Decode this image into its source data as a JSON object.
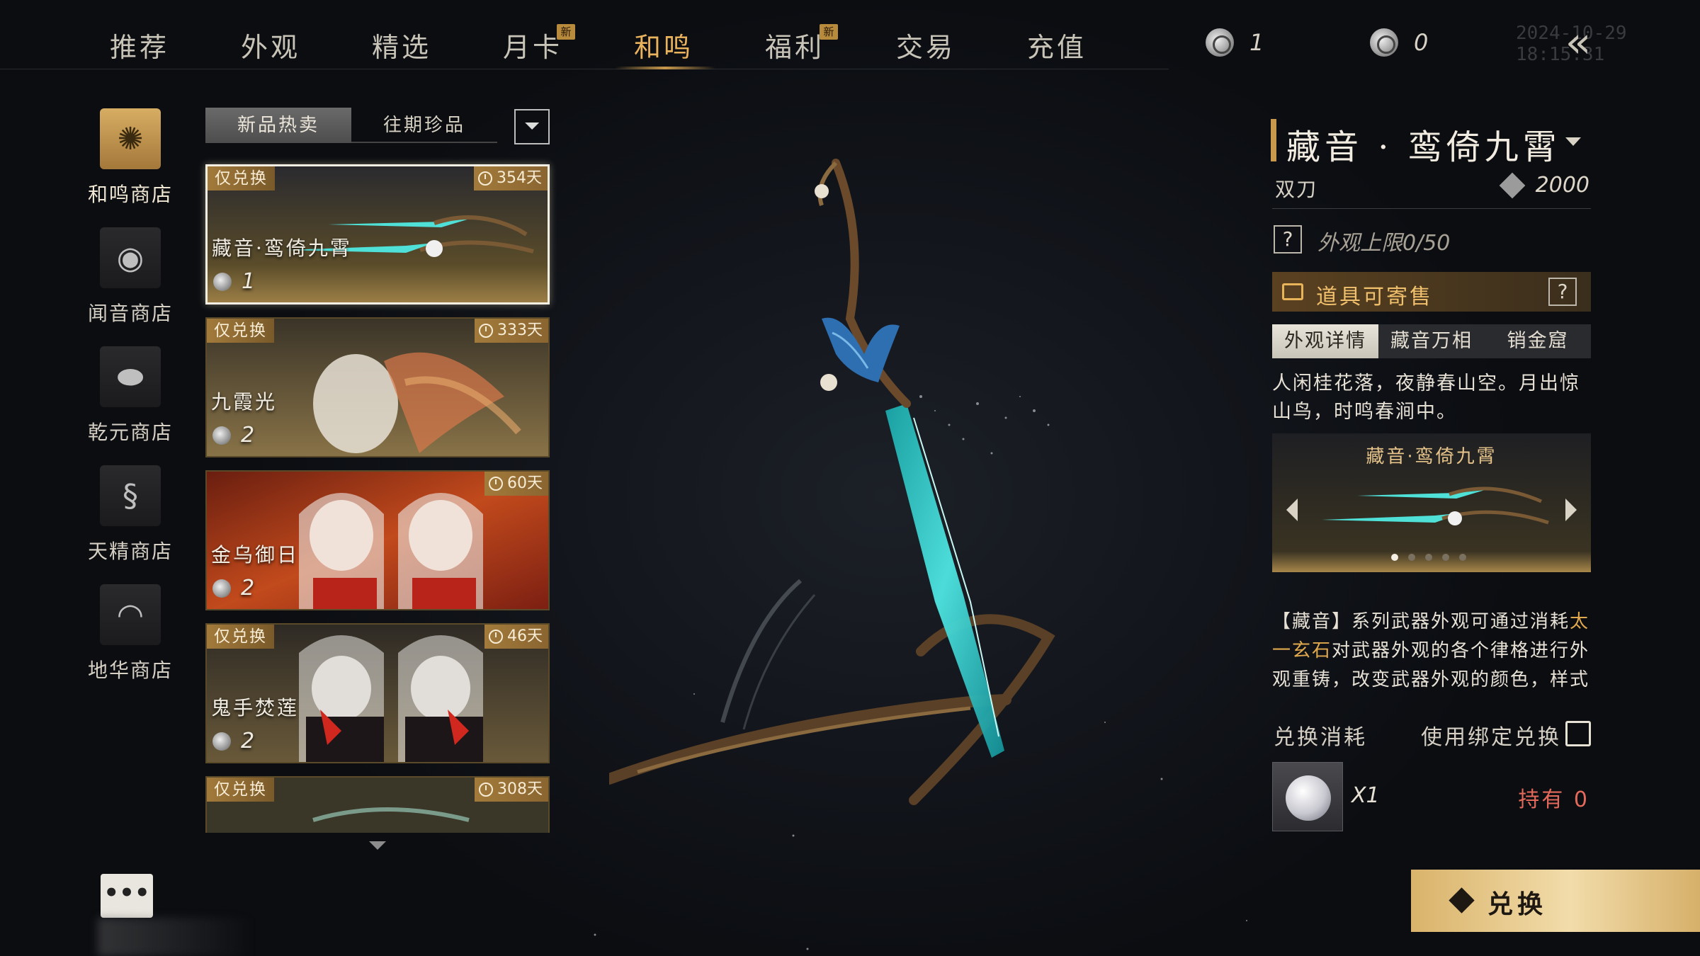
{
  "nav": {
    "tabs": [
      {
        "label": "推荐"
      },
      {
        "label": "外观"
      },
      {
        "label": "精选"
      },
      {
        "label": "月卡",
        "badge": "新"
      },
      {
        "label": "和鸣",
        "active": true
      },
      {
        "label": "福利",
        "badge": "新"
      },
      {
        "label": "交易"
      },
      {
        "label": "充值"
      }
    ],
    "currency1": "1",
    "currency2": "0",
    "timestamp": "2024-10-29 18:15:31",
    "back_icon": "double-chevron-left-icon"
  },
  "shops": [
    {
      "label": "和鸣商店",
      "icon": "coin-emblem-icon",
      "active": true
    },
    {
      "label": "闻音商店",
      "icon": "seal-icon"
    },
    {
      "label": "乾元商店",
      "icon": "stone-icon"
    },
    {
      "label": "天精商店",
      "icon": "dragon-icon"
    },
    {
      "label": "地华商店",
      "icon": "lips-icon"
    }
  ],
  "list": {
    "subtab_active": "新品热卖",
    "subtab_inactive": "往期珍品",
    "filter_icon": "filter-icon",
    "cards": [
      {
        "badge": "仅兑换",
        "days": "354天",
        "name": "藏音·鸾倚九霄",
        "price": "1",
        "selected": true
      },
      {
        "badge": "仅兑换",
        "days": "333天",
        "name": "九霞光",
        "price": "2"
      },
      {
        "badge": "",
        "days": "60天",
        "name": "金乌御日",
        "price": "2"
      },
      {
        "badge": "仅兑换",
        "days": "46天",
        "name": "鬼手焚莲",
        "price": "2"
      },
      {
        "badge": "仅兑换",
        "days": "308天",
        "name": "",
        "price": ""
      }
    ]
  },
  "more_label": "•••",
  "detail": {
    "title": "藏音 · 鸾倚九霄",
    "type": "双刀",
    "score": "2000",
    "limit": "外观上限0/50",
    "tradable": "道具可寄售",
    "tabs": [
      "外观详情",
      "藏音万相",
      "销金窟"
    ],
    "description": "人闲桂花落，夜静春山空。月出惊山鸟，时鸣春涧中。",
    "preview_title": "藏音·鸾倚九霄",
    "lore_pre": "【藏音】系列武器外观可通过消耗",
    "lore_highlight": "太一玄石",
    "lore_post": "对武器外观的各个律格进行外观重铸，改变武器外观的颜色，样式",
    "cost_label": "兑换消耗",
    "bind_label": "使用绑定兑换",
    "cost_qty": "X1",
    "held": "持有 0",
    "exchange_label": "兑换"
  },
  "colors": {
    "accent_gold": "#c8994c",
    "active_tab": "#e9b25c",
    "held_red": "#e36a5a",
    "weapon_teal": "#3fd8d8"
  }
}
